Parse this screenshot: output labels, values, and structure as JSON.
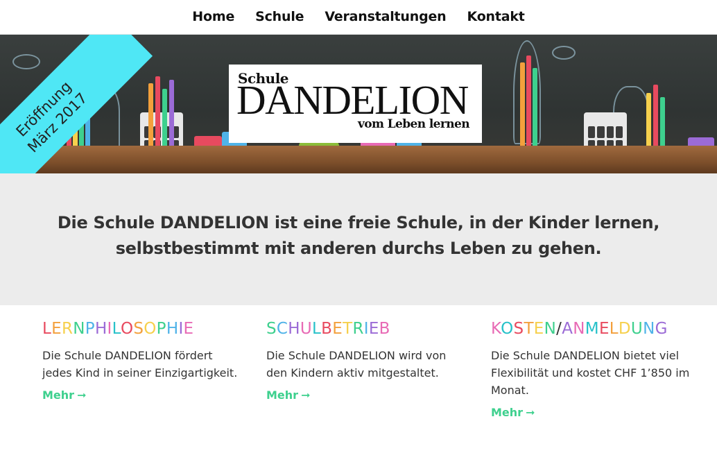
{
  "nav": {
    "items": [
      "Home",
      "Schule",
      "Veranstaltungen",
      "Kontakt"
    ]
  },
  "hero": {
    "logo_top": "Schule",
    "logo_main": "DANDELION",
    "logo_sub": "vom Leben lernen",
    "ribbon_line1": "Eröffnung",
    "ribbon_line2": "März 2017",
    "ribbon_color": "#4fe7f5"
  },
  "intro": {
    "text": "Die Schule DANDELION ist eine freie Schule, in der Kinder lernen, selbstbestimmt mit anderen durchs Leben zu gehen."
  },
  "columns": [
    {
      "title": "LERNPHILOSOPHIE",
      "text": "Die Schule DANDELION fördert jedes Kind in seiner Einzigartigkeit.",
      "more": "Mehr",
      "more_icon": "arrow-right-icon"
    },
    {
      "title": "SCHULBETRIEB",
      "text": "Die Schule DANDELION wird von den Kindern aktiv mitgestaltet.",
      "more": "Mehr",
      "more_icon": "arrow-right-icon"
    },
    {
      "title": "KOSTEN/ANMELDUNG",
      "text": "Die Schule DANDELION bietet viel Flexibilität und kostet CHF 1’850 im Monat.",
      "more": "Mehr",
      "more_icon": "arrow-right-icon"
    }
  ],
  "colors": {
    "link": "#3ed08e",
    "heading_letters": [
      "#e84a5f",
      "#f3a03c",
      "#f6d04d",
      "#3ed08e",
      "#4fb3e8",
      "#9b6bd6",
      "#e86ab5",
      "#27c1c9"
    ]
  }
}
